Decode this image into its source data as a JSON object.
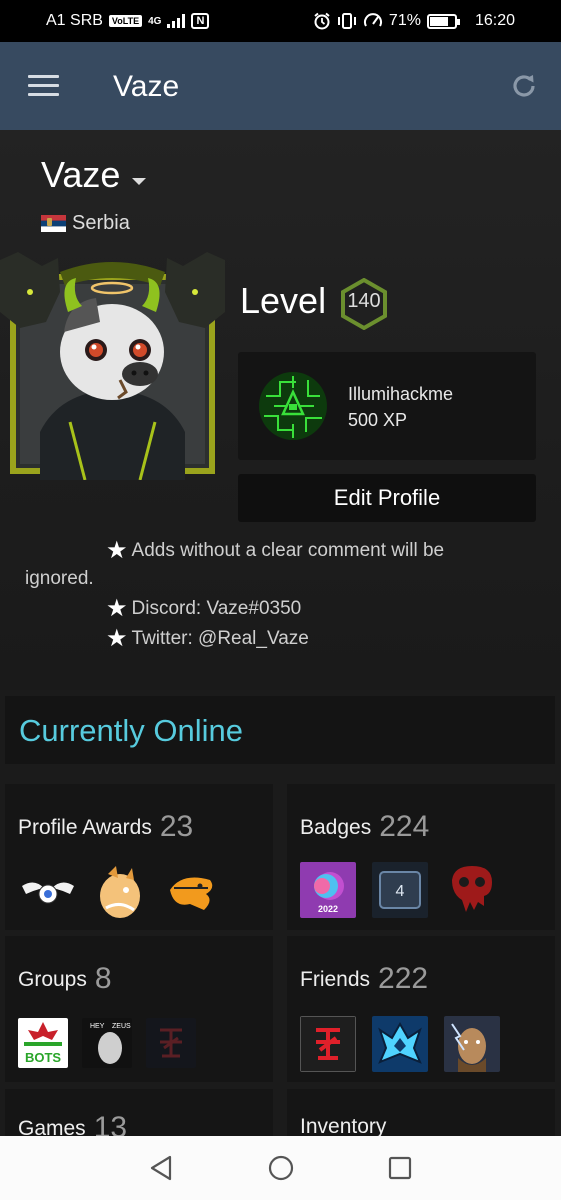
{
  "status_bar": {
    "carrier": "A1 SRB",
    "volte": "VoLTE",
    "network": "4G",
    "nfc": "N",
    "battery": "71%",
    "time": "16:20"
  },
  "app_bar": {
    "title": "Vaze"
  },
  "profile": {
    "name": "Vaze",
    "country": "Serbia",
    "level_label": "Level",
    "level": "140",
    "badge_name": "Illumihackme",
    "badge_xp": "500 XP",
    "edit_button": "Edit Profile",
    "summary_lines": [
      "Adds without a clear comment will be",
      "ignored.",
      "Discord: Vaze#0350",
      "Twitter: @Real_Vaze"
    ]
  },
  "status": {
    "online_text": "Currently Online"
  },
  "sections": {
    "awards": {
      "label": "Profile Awards",
      "count": "23"
    },
    "badges": {
      "label": "Badges",
      "count": "224",
      "thumb_text": [
        "2022",
        "4"
      ]
    },
    "groups": {
      "label": "Groups",
      "count": "8",
      "thumb_text": [
        "BOTS",
        "HEY",
        "ZEUS"
      ]
    },
    "friends": {
      "label": "Friends",
      "count": "222"
    },
    "games": {
      "label": "Games",
      "count": "13"
    },
    "inventory": {
      "label": "Inventory"
    }
  },
  "colors": {
    "app_bar": "#374a60",
    "online_blue": "#57cbde",
    "card_bg": "#151515",
    "page_bg": "#1b1b1b"
  }
}
